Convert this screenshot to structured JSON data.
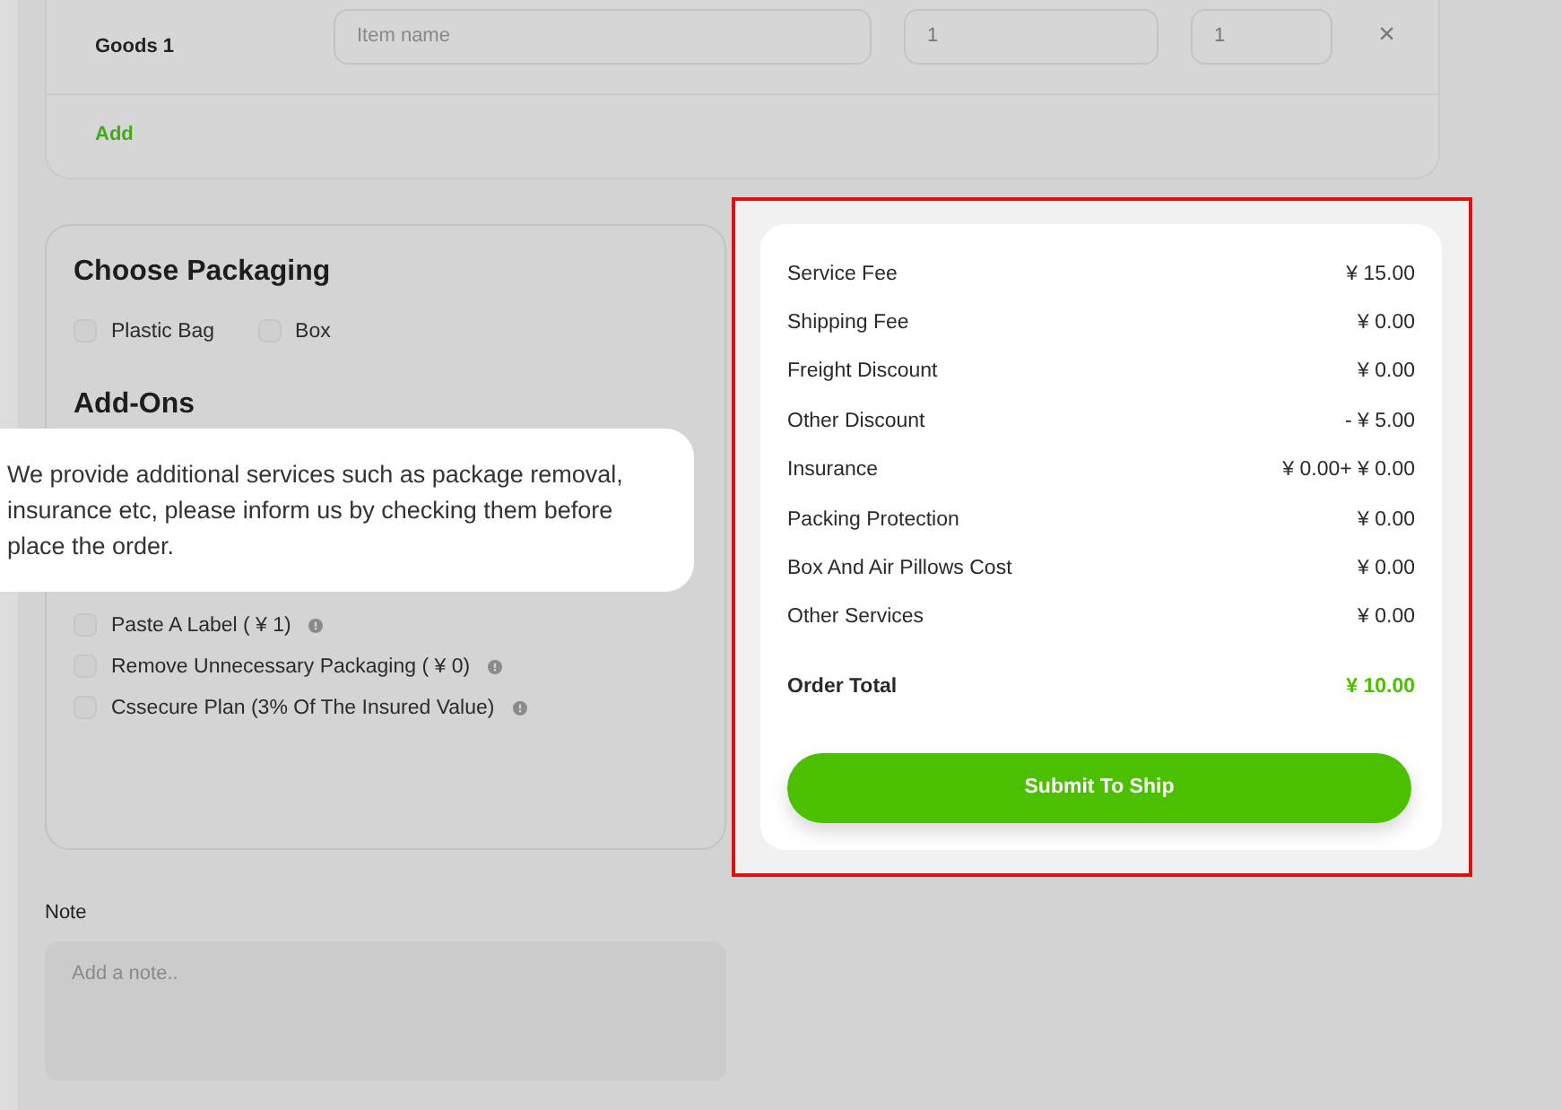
{
  "goods": {
    "rows": [
      {
        "label": "Goods 1",
        "name_placeholder": "Item name",
        "quantity": "1",
        "value": "1",
        "remove": "×"
      }
    ],
    "add_link": "Add"
  },
  "packaging": {
    "title": "Choose Packaging",
    "options": [
      {
        "label": "Plastic Bag",
        "checked": false
      },
      {
        "label": "Box",
        "checked": false
      }
    ]
  },
  "add_ons": {
    "title": "Add-Ons",
    "options": [
      {
        "label": "Paste A Label ( ¥ 1)",
        "checked": false
      },
      {
        "label": "Remove Unnecessary Packaging ( ¥ 0)",
        "checked": false
      },
      {
        "label": "Cssecure Plan (3% Of The Insured Value)",
        "checked": false
      }
    ]
  },
  "note": {
    "label": "Note",
    "placeholder": "Add a note.."
  },
  "summary": {
    "rows": [
      {
        "label": "Service Fee",
        "value": "¥ 15.00"
      },
      {
        "label": "Shipping Fee",
        "value": "¥ 0.00"
      },
      {
        "label": "Freight Discount",
        "value": "¥ 0.00"
      },
      {
        "label": "Other Discount",
        "value": "- ¥ 5.00"
      },
      {
        "label": "Insurance",
        "value": "¥ 0.00+ ¥ 0.00"
      },
      {
        "label": "Packing Protection",
        "value": "¥ 0.00"
      },
      {
        "label": "Box And Air Pillows Cost",
        "value": "¥ 0.00"
      },
      {
        "label": "Other Services",
        "value": "¥ 0.00"
      }
    ],
    "total": {
      "label": "Order Total",
      "value": "¥ 10.00"
    },
    "button": "Submit To Ship"
  },
  "hint": {
    "text": "We provide additional services such as package removal, insurance etc, please inform us by checking them before place the order."
  }
}
